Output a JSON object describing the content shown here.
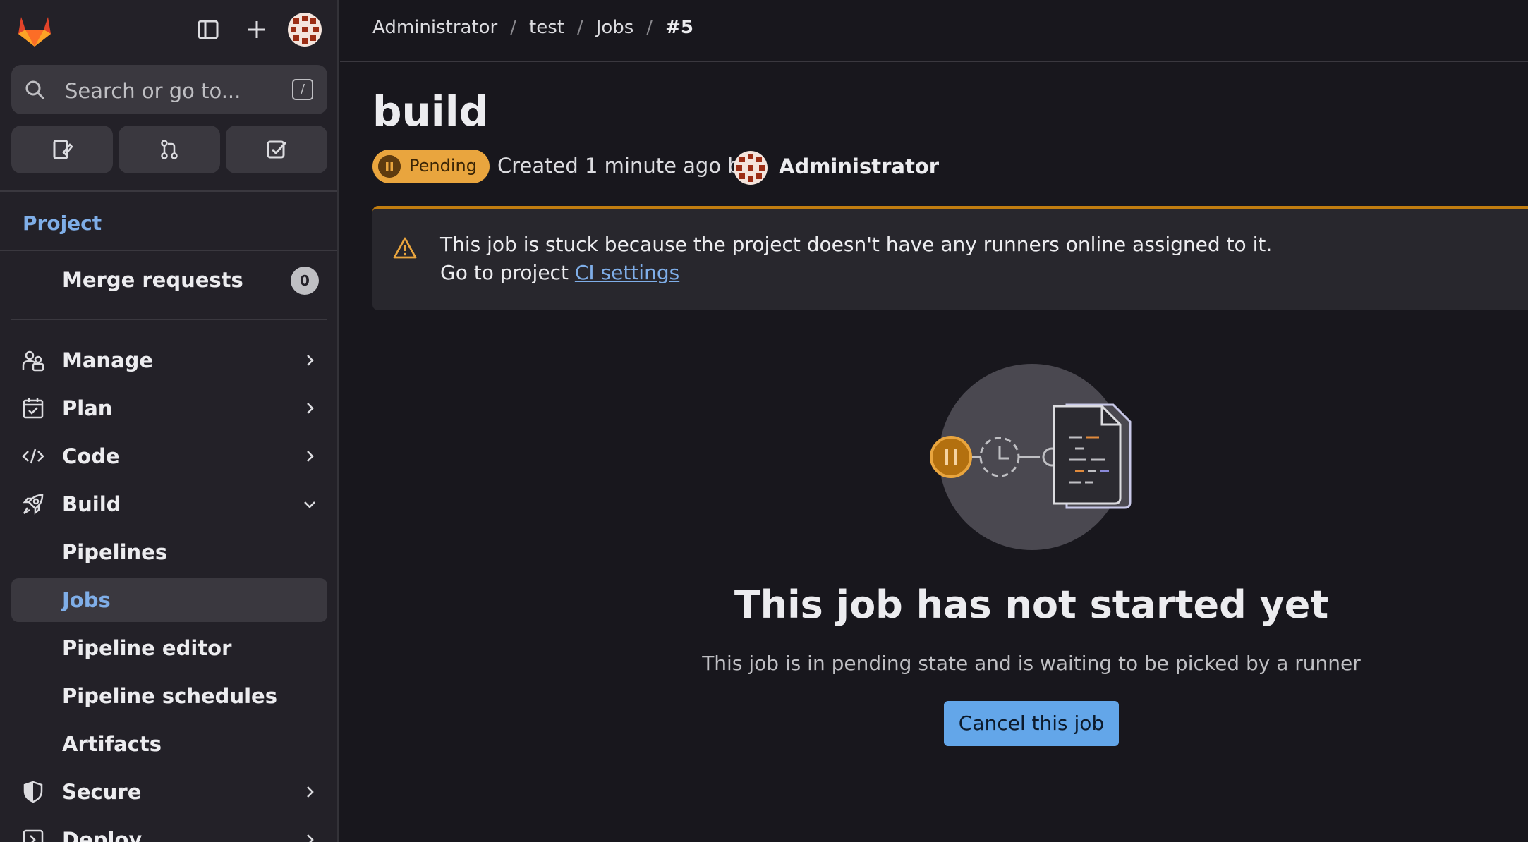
{
  "sidebar": {
    "search_placeholder": "Search or go to...",
    "search_shortcut": "/",
    "section_title": "Project",
    "merge_requests": {
      "label": "Merge requests",
      "count": "0"
    },
    "groups": [
      {
        "label": "Manage",
        "icon": "users-icon"
      },
      {
        "label": "Plan",
        "icon": "calendar-icon"
      },
      {
        "label": "Code",
        "icon": "code-icon"
      },
      {
        "label": "Build",
        "icon": "rocket-icon"
      }
    ],
    "build_items": [
      {
        "label": "Pipelines"
      },
      {
        "label": "Jobs"
      },
      {
        "label": "Pipeline editor"
      },
      {
        "label": "Pipeline schedules"
      },
      {
        "label": "Artifacts"
      }
    ],
    "secure": {
      "label": "Secure"
    },
    "deploy": {
      "label": "Deploy"
    }
  },
  "breadcrumb": {
    "items": [
      "Administrator",
      "test",
      "Jobs"
    ],
    "current": "#5"
  },
  "job": {
    "name": "build",
    "status": "Pending",
    "created_text": "Created 1 minute ago by",
    "author": "Administrator"
  },
  "alert": {
    "line1": "This job is stuck because the project doesn't have any runners online assigned to it.",
    "line2_prefix": "Go to project",
    "link_text": "CI settings"
  },
  "empty_state": {
    "title": "This job has not started yet",
    "description": "This job is in pending state and is waiting to be picked by a runner",
    "button": "Cancel this job"
  },
  "colors": {
    "accent_blue": "#63a6e9",
    "pending_orange": "#e9a53e",
    "alert_border": "#c17d10",
    "link": "#7faee8"
  }
}
